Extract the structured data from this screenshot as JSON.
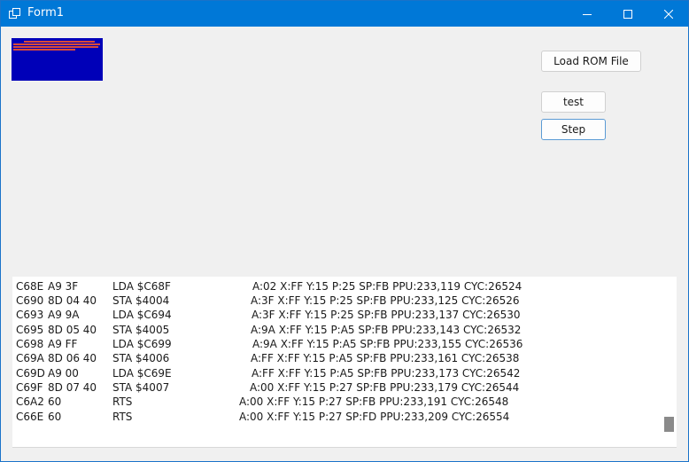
{
  "window": {
    "title": "Form1",
    "controls": {
      "minimize": "minimize",
      "maximize": "maximize",
      "close": "close"
    }
  },
  "colors": {
    "titlebar": "#0078d7",
    "display_bg": "#0000b8",
    "display_text": "#d94a3a"
  },
  "buttons": {
    "load_rom": "Load ROM File",
    "test": "test",
    "step": "Step"
  },
  "log": {
    "rows": [
      {
        "addr": "C68E",
        "bytes": "A9 3F",
        "instr": "LDA $C68F",
        "state": "A:02 X:FF Y:15 P:25 SP:FB PPU:233,119 CYC:26524"
      },
      {
        "addr": "C690",
        "bytes": "8D 04 40",
        "instr": "STA $4004",
        "state": "A:3F X:FF Y:15 P:25 SP:FB PPU:233,125 CYC:26526"
      },
      {
        "addr": "C693",
        "bytes": "A9 9A",
        "instr": "LDA $C694",
        "state": "A:3F X:FF Y:15 P:25 SP:FB PPU:233,137 CYC:26530"
      },
      {
        "addr": "C695",
        "bytes": "8D 05 40",
        "instr": "STA $4005",
        "state": "A:9A X:FF Y:15 P:A5 SP:FB PPU:233,143 CYC:26532"
      },
      {
        "addr": "C698",
        "bytes": "A9 FF",
        "instr": "LDA $C699",
        "state": "A:9A X:FF Y:15 P:A5 SP:FB PPU:233,155 CYC:26536"
      },
      {
        "addr": "C69A",
        "bytes": "8D 06 40",
        "instr": "STA $4006",
        "state": "A:FF X:FF Y:15 P:A5 SP:FB PPU:233,161 CYC:26538"
      },
      {
        "addr": "C69D",
        "bytes": "A9 00",
        "instr": "LDA $C69E",
        "state": "A:FF X:FF Y:15 P:A5 SP:FB PPU:233,173 CYC:26542"
      },
      {
        "addr": "C69F",
        "bytes": "8D 07 40",
        "instr": "STA $4007",
        "state": "A:00 X:FF Y:15 P:27 SP:FB PPU:233,179 CYC:26544"
      },
      {
        "addr": "C6A2",
        "bytes": "60",
        "instr": "RTS",
        "state": "A:00 X:FF Y:15 P:27 SP:FB PPU:233,191 CYC:26548"
      },
      {
        "addr": "C66E",
        "bytes": "60",
        "instr": "RTS",
        "state": "A:00 X:FF Y:15 P:27 SP:FD PPU:233,209 CYC:26554"
      }
    ]
  }
}
